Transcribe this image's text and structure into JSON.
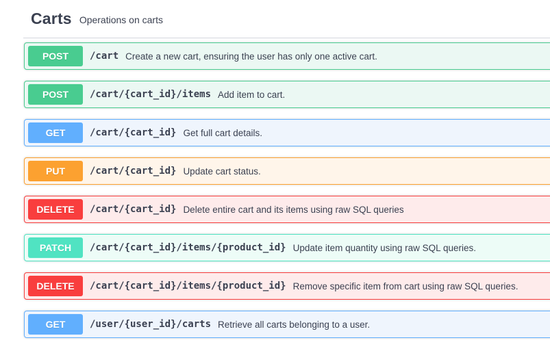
{
  "tag": {
    "name": "Carts",
    "description": "Operations on carts"
  },
  "operations": [
    {
      "method": "POST",
      "path": "/cart",
      "summary": "Create a new cart, ensuring the user has only one active cart."
    },
    {
      "method": "POST",
      "path": "/cart/{cart_id}/items",
      "summary": "Add item to cart."
    },
    {
      "method": "GET",
      "path": "/cart/{cart_id}",
      "summary": "Get full cart details."
    },
    {
      "method": "PUT",
      "path": "/cart/{cart_id}",
      "summary": "Update cart status."
    },
    {
      "method": "DELETE",
      "path": "/cart/{cart_id}",
      "summary": "Delete entire cart and its items using raw SQL queries"
    },
    {
      "method": "PATCH",
      "path": "/cart/{cart_id}/items/{product_id}",
      "summary": "Update item quantity using raw SQL queries."
    },
    {
      "method": "DELETE",
      "path": "/cart/{cart_id}/items/{product_id}",
      "summary": "Remove specific item from cart using raw SQL queries."
    },
    {
      "method": "GET",
      "path": "/user/{user_id}/carts",
      "summary": "Retrieve all carts belonging to a user."
    }
  ],
  "colors": {
    "POST": "#49cc90",
    "GET": "#61affe",
    "PUT": "#fca130",
    "DELETE": "#f93e3e",
    "PATCH": "#50e3c2"
  }
}
